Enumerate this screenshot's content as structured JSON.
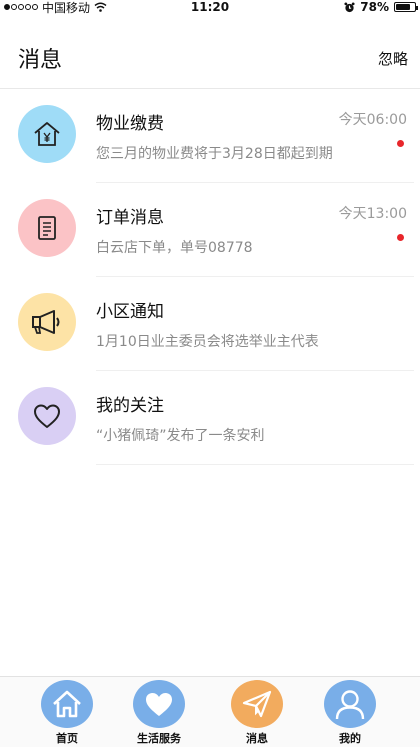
{
  "status_bar": {
    "carrier": "中国移动",
    "time": "11:20",
    "battery": "78%",
    "battery_level": 0.78
  },
  "header": {
    "title": "消息",
    "ignore_label": "忽略"
  },
  "messages": [
    {
      "title": "物业缴费",
      "time": "今天06:00",
      "subtitle": "您三月的物业费将于3月28日都起到期",
      "unread": true,
      "icon": "house-yen-icon",
      "color": "#9fdcf7"
    },
    {
      "title": "订单消息",
      "time": "今天13:00",
      "subtitle": "白云店下单，单号08778",
      "unread": true,
      "icon": "document-icon",
      "color": "#fbc3c6"
    },
    {
      "title": "小区通知",
      "time": "",
      "subtitle": "1月10日业主委员会将选举业主代表",
      "unread": false,
      "icon": "megaphone-icon",
      "color": "#fde3a6"
    },
    {
      "title": "我的关注",
      "time": "",
      "subtitle": "“小猪佩琦”发布了一条安利",
      "unread": false,
      "icon": "heart-icon",
      "color": "#d9cff4"
    }
  ],
  "tabs": [
    {
      "label": "首页",
      "icon": "home-icon",
      "color": "#79aee8"
    },
    {
      "label": "生活服务",
      "icon": "heart-icon",
      "color": "#79aee8"
    },
    {
      "label": "消息",
      "icon": "paper-plane-icon",
      "color": "#f2ab5e",
      "active": true
    },
    {
      "label": "我的",
      "icon": "person-icon",
      "color": "#79aee8"
    }
  ]
}
